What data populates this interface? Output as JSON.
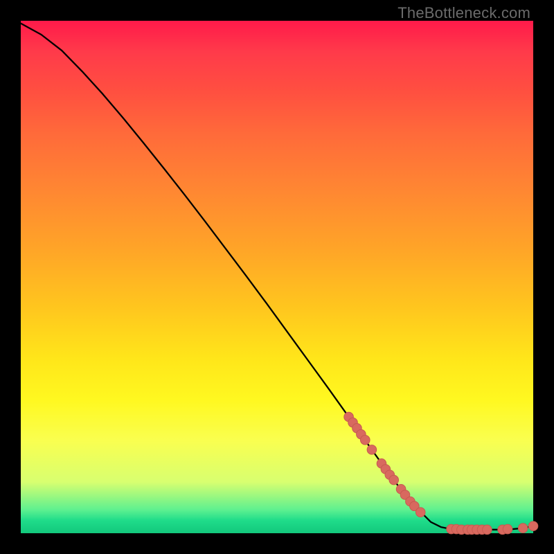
{
  "watermark": "TheBottleneck.com",
  "colors": {
    "background": "#000000",
    "curve_stroke": "#000000",
    "marker_fill": "#d8695f",
    "marker_stroke": "#c65a50"
  },
  "chart_data": {
    "type": "line",
    "title": "",
    "xlabel": "",
    "ylabel": "",
    "xlim": [
      0,
      100
    ],
    "ylim": [
      0,
      100
    ],
    "grid": false,
    "legend": false,
    "x": [
      0,
      4,
      8,
      12,
      16,
      20,
      24,
      28,
      32,
      36,
      40,
      44,
      48,
      52,
      56,
      60,
      64,
      68,
      72,
      76,
      80,
      82,
      84,
      86,
      88,
      90,
      92,
      94,
      96,
      98,
      100
    ],
    "y": [
      99.5,
      97.3,
      94.2,
      90.1,
      85.7,
      81.0,
      76.1,
      71.1,
      66.0,
      60.8,
      55.5,
      50.2,
      44.8,
      39.3,
      33.8,
      28.3,
      22.7,
      17.0,
      11.4,
      6.2,
      2.2,
      1.2,
      0.8,
      0.7,
      0.7,
      0.7,
      0.7,
      0.7,
      0.8,
      1.0,
      1.4
    ],
    "markers": [
      {
        "x": 64,
        "y": 22.7
      },
      {
        "x": 64.8,
        "y": 21.6
      },
      {
        "x": 65.6,
        "y": 20.5
      },
      {
        "x": 66.4,
        "y": 19.3
      },
      {
        "x": 67.2,
        "y": 18.2
      },
      {
        "x": 68.5,
        "y": 16.3
      },
      {
        "x": 70.4,
        "y": 13.6
      },
      {
        "x": 71.2,
        "y": 12.5
      },
      {
        "x": 72.0,
        "y": 11.4
      },
      {
        "x": 72.8,
        "y": 10.4
      },
      {
        "x": 74.2,
        "y": 8.6
      },
      {
        "x": 75.0,
        "y": 7.5
      },
      {
        "x": 76.0,
        "y": 6.2
      },
      {
        "x": 76.8,
        "y": 5.3
      },
      {
        "x": 78.0,
        "y": 4.1
      },
      {
        "x": 84.0,
        "y": 0.8
      },
      {
        "x": 85.0,
        "y": 0.8
      },
      {
        "x": 86.0,
        "y": 0.7
      },
      {
        "x": 87.2,
        "y": 0.7
      },
      {
        "x": 88.0,
        "y": 0.7
      },
      {
        "x": 89.0,
        "y": 0.7
      },
      {
        "x": 90.0,
        "y": 0.7
      },
      {
        "x": 91.0,
        "y": 0.7
      },
      {
        "x": 94.0,
        "y": 0.7
      },
      {
        "x": 95.0,
        "y": 0.8
      },
      {
        "x": 98.0,
        "y": 1.0
      },
      {
        "x": 100.0,
        "y": 1.4
      }
    ]
  }
}
